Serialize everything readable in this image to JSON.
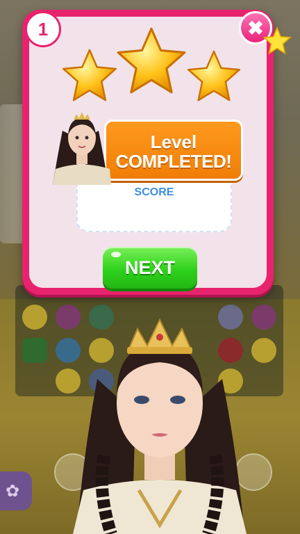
{
  "level": {
    "number": "1"
  },
  "close": {
    "symbol": "✖"
  },
  "stars": {
    "earned": 3,
    "total": 3
  },
  "result": {
    "line1": "Level",
    "line2": "COMPLETED!"
  },
  "score": {
    "label": "SCORE"
  },
  "next": {
    "label": "NEXT"
  },
  "colors": {
    "popup_frame": "#e8236e",
    "popup_body": "#f2e3ea",
    "banner": "#f08a10",
    "score_label": "#3b8fe0",
    "next_button": "#2fd21c",
    "star": "#ffc21a"
  },
  "icons": {
    "close": "close-icon",
    "level": "level-badge",
    "side_menu": "flower-icon"
  }
}
